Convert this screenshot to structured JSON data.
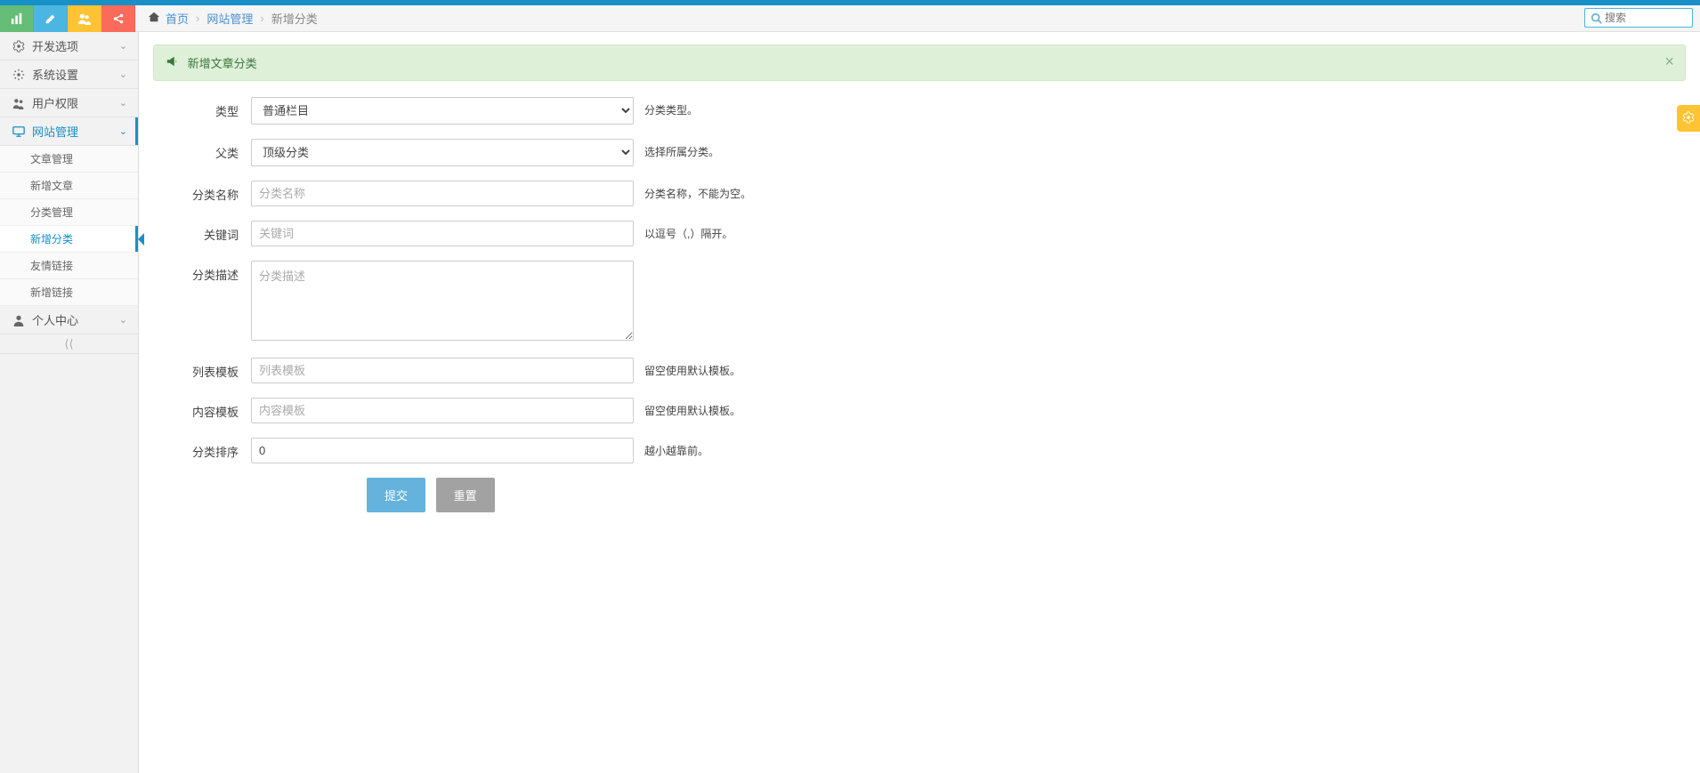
{
  "breadcrumb": {
    "home": "首页",
    "mid": "网站管理",
    "current": "新增分类"
  },
  "search": {
    "placeholder": "搜索"
  },
  "sidebar": {
    "items": [
      {
        "icon": "gear",
        "label": "开发选项"
      },
      {
        "icon": "gear",
        "label": "系统设置"
      },
      {
        "icon": "users",
        "label": "用户权限"
      },
      {
        "icon": "monitor",
        "label": "网站管理",
        "active": true
      },
      {
        "icon": "user",
        "label": "个人中心"
      }
    ],
    "submenu": [
      {
        "label": "文章管理"
      },
      {
        "label": "新增文章"
      },
      {
        "label": "分类管理"
      },
      {
        "label": "新增分类",
        "active": true
      },
      {
        "label": "友情链接"
      },
      {
        "label": "新增链接"
      }
    ]
  },
  "alert": {
    "text": "新增文章分类"
  },
  "form": {
    "type": {
      "label": "类型",
      "value": "普通栏目",
      "help": "分类类型。"
    },
    "parent": {
      "label": "父类",
      "value": "顶级分类",
      "help": "选择所属分类。"
    },
    "name": {
      "label": "分类名称",
      "placeholder": "分类名称",
      "help": "分类名称，不能为空。"
    },
    "keywords": {
      "label": "关键词",
      "placeholder": "关键词",
      "help": "以逗号（,）隔开。"
    },
    "desc": {
      "label": "分类描述",
      "placeholder": "分类描述",
      "help": ""
    },
    "listTpl": {
      "label": "列表模板",
      "placeholder": "列表模板",
      "help": "留空使用默认模板。"
    },
    "contTpl": {
      "label": "内容模板",
      "placeholder": "内容模板",
      "help": "留空使用默认模板。"
    },
    "sort": {
      "label": "分类排序",
      "value": "0",
      "help": "越小越靠前。"
    },
    "submit": "提交",
    "reset": "重置"
  }
}
